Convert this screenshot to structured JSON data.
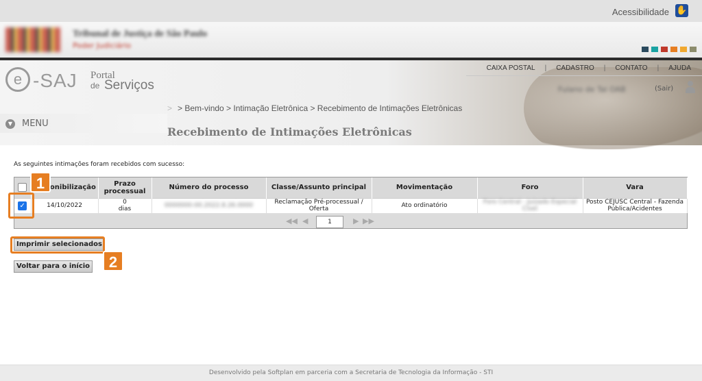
{
  "accessibility": {
    "label": "Acessibilidade",
    "icon": "sign-language-icon"
  },
  "tj_header": {
    "title": "Tribunal de Justiça de São Paulo",
    "subtitle": "Poder Judiciário",
    "swatch_colors": [
      "#2b4a5e",
      "#1aa3a3",
      "#c0392b",
      "#e67e22",
      "#f0a830",
      "#8c8c6c"
    ]
  },
  "esaj": {
    "e": "e",
    "word": "-SAJ",
    "portal": "Portal",
    "de": "de",
    "servicos": "Serviços"
  },
  "topnav": {
    "items": [
      "CAIXA POSTAL",
      "CADASTRO",
      "CONTATO",
      "AJUDA"
    ],
    "separator": "|"
  },
  "user": {
    "name": "Fulano de Tal OAB",
    "logout": "(Sair)"
  },
  "breadcrumb": {
    "arrow": ">",
    "text": "> Bem-vindo > Intimação Eletrônica > Recebimento de Intimações Eletrônicas"
  },
  "menu": {
    "label": "MENU"
  },
  "page_title": "Recebimento de Intimações Eletrônicas",
  "message": "As seguintes intimações foram recebidos com sucesso:",
  "table": {
    "headers": [
      "",
      "Disponibilização",
      "Prazo processual",
      "Número do processo",
      "Classe/Assunto principal",
      "Movimentação",
      "Foro",
      "Vara"
    ],
    "row": {
      "checked": true,
      "date": "14/10/2022",
      "prazo": "0\ndias",
      "numero": "0000000-00.2022.8.26.0000",
      "classe": "Reclamação Pré-processual / Oferta",
      "movimentacao": "Ato ordinatório",
      "foro": "Foro Central - Juizado Especial Cível",
      "vara": "Posto CEJUSC Central - Fazenda Pública/Acidentes"
    },
    "pager": {
      "page": "1"
    }
  },
  "annotations": {
    "badge1": "1",
    "badge2": "2",
    "color": "#e67e22"
  },
  "buttons": {
    "print": "Imprimir selecionados",
    "back": "Voltar para o início"
  },
  "footer": "Desenvolvido pela Softplan em parceria com a Secretaria de Tecnologia da Informação - STI"
}
